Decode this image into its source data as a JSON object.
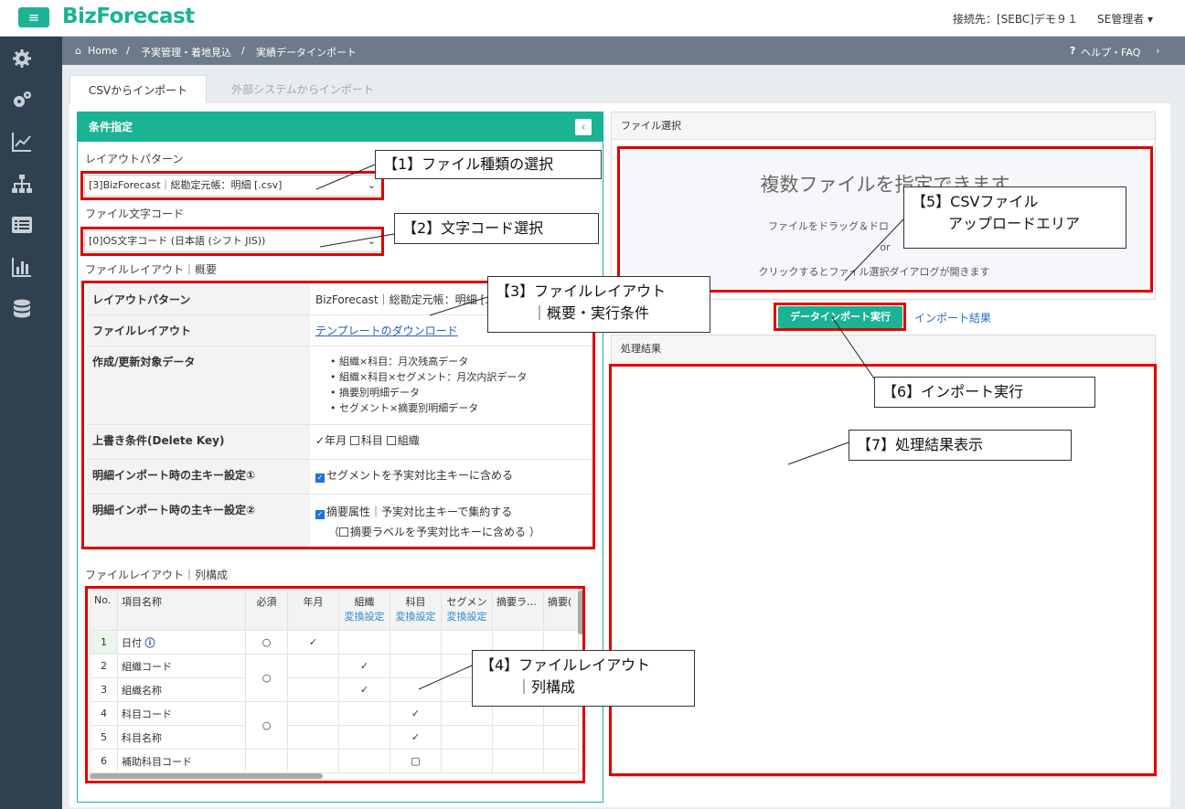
{
  "header": {
    "menu_label": "≡",
    "logo": "BizForecast",
    "connection": "接続先：[SEBC]デモ９１",
    "user": "SE管理者"
  },
  "sidebar": {
    "icons": [
      "gear-icon",
      "gears-icon",
      "line-chart-icon",
      "sitemap-icon",
      "list-icon",
      "bar-chart-icon",
      "database-icon"
    ]
  },
  "breadcrumb": {
    "home": "Home",
    "sep": "/",
    "level1": "予実管理・着地見込",
    "level2": "実績データインポート",
    "help": "ヘルプ・FAQ"
  },
  "tabs": [
    {
      "label": "CSVからインポート"
    },
    {
      "label": "外部システムからインポート"
    }
  ],
  "conditions": {
    "title": "条件指定",
    "layout_pattern_label": "レイアウトパターン",
    "layout_pattern_value": "[3]BizForecast｜総勘定元帳：明細 [.csv]",
    "encoding_label": "ファイル文字コード",
    "encoding_value": "[0]OS文字コード (日本語 (シフト JIS))",
    "overview_label": "ファイルレイアウト｜概要",
    "overview": {
      "k1": "レイアウトパターン",
      "v1": "BizForecast｜総勘定元帳：明細 [.c",
      "k2": "ファイルレイアウト",
      "v2": "テンプレートのダウンロード",
      "k3": "作成/更新対象データ",
      "v3": [
        "組織×科目：月次残高データ",
        "組織×科目×セグメント：月次内訳データ",
        "摘要別明細データ",
        "セグメント×摘要別明細データ"
      ],
      "k4": "上書き条件(Delete Key)",
      "v4a": "年月",
      "v4b": "科目",
      "v4c": "組織",
      "k5": "明細インポート時の主キー設定①",
      "v5": "セグメントを予実対比主キーに含める",
      "k6": "明細インポート時の主キー設定②",
      "v6a": "摘要属性｜予実対比主キーで集約する",
      "v6b": "（",
      "v6c": "摘要ラベルを予実対比キーに含める ）"
    },
    "columns_label": "ファイルレイアウト｜列構成",
    "columns": {
      "headers": {
        "no": "No.",
        "name": "項目名称",
        "req": "必須",
        "ym": "年月",
        "org": "組織",
        "acc": "科目",
        "seg": "セグメン",
        "sum1": "摘要ラ…",
        "sum2": "摘要(",
        "conv": "変換設定"
      },
      "rows": [
        {
          "no": "1",
          "name": "日付",
          "req": "○",
          "ym": "✓",
          "org": "",
          "acc": ""
        },
        {
          "no": "2",
          "name": "組織コード",
          "req": "",
          "ym": "",
          "org": "✓",
          "acc": ""
        },
        {
          "no": "3",
          "name": "組織名称",
          "req": "",
          "ym": "",
          "org": "✓",
          "acc": ""
        },
        {
          "no": "4",
          "name": "科目コード",
          "req": "",
          "ym": "",
          "org": "",
          "acc": "✓"
        },
        {
          "no": "5",
          "name": "科目名称",
          "req": "",
          "ym": "",
          "org": "",
          "acc": "✓"
        },
        {
          "no": "6",
          "name": "補助科目コード",
          "req": "",
          "ym": "",
          "org": "",
          "acc": "▢"
        }
      ],
      "merged_req": "○"
    }
  },
  "file_select": {
    "title": "ファイル選択",
    "big": "複数ファイルを指定できます",
    "drag": "ファイルをドラッグ＆ドロ",
    "or": "or",
    "click": "クリックするとファイル選択ダイアログが開きます"
  },
  "actions": {
    "run": "データインポート実行",
    "result_link": "インポート結果"
  },
  "result": {
    "title": "処理結果"
  },
  "callouts": {
    "c1": "【1】ファイル種類の選択",
    "c2": "【2】文字コード選択",
    "c3a": "【3】ファイルレイアウト",
    "c3b": "｜概要・実行条件",
    "c4a": "【4】ファイルレイアウト",
    "c4b": "｜列構成",
    "c5a": "【5】CSVファイル",
    "c5b": "アップロードエリア",
    "c6": "【6】インポート実行",
    "c7": "【7】処理結果表示"
  },
  "colors": {
    "accent": "#1ab394",
    "sidebar": "#2f4050",
    "breadcrumb": "#6c7a89",
    "annotation": "#e00000"
  }
}
